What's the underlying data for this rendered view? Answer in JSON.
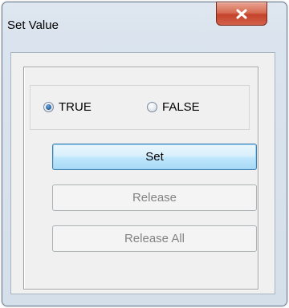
{
  "window": {
    "title": "Set Value",
    "close_glyph": "X"
  },
  "radio_group": {
    "options": [
      {
        "label": "TRUE",
        "checked": true
      },
      {
        "label": "FALSE",
        "checked": false
      }
    ]
  },
  "buttons": {
    "set_label": "Set",
    "release_label": "Release",
    "release_all_label": "Release All"
  },
  "colors": {
    "close_button_red": "#c4432b",
    "focused_button_blue": "#3c7fb1",
    "disabled_text": "#838383"
  }
}
